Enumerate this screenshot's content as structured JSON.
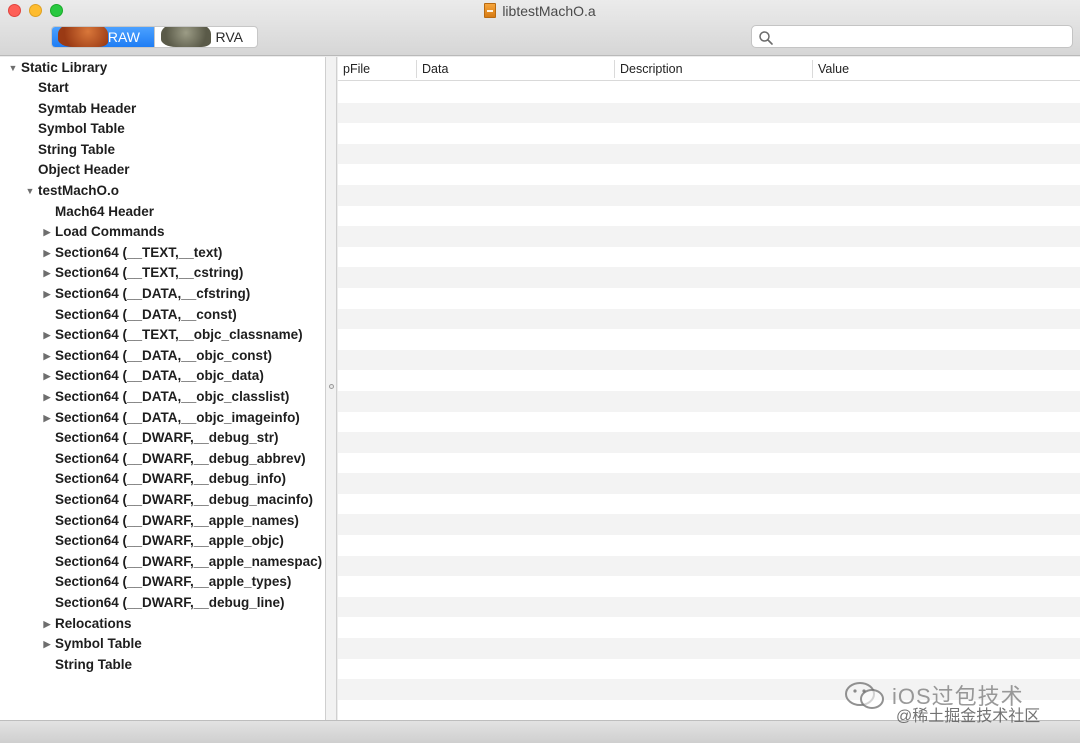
{
  "window": {
    "title": "libtestMachO.a"
  },
  "toolbar": {
    "mode_raw": "RAW",
    "mode_rva": "RVA",
    "search_value": "",
    "search_placeholder": ""
  },
  "sidebar": {
    "items": [
      {
        "label": "Static Library",
        "expanded": true
      },
      {
        "label": "Start"
      },
      {
        "label": "Symtab Header"
      },
      {
        "label": "Symbol Table"
      },
      {
        "label": "String Table"
      },
      {
        "label": "Object Header"
      },
      {
        "label": "testMachO.o",
        "expanded": true
      },
      {
        "label": "Mach64 Header"
      },
      {
        "label": "Load Commands",
        "expandable": true
      },
      {
        "label": "Section64 (__TEXT,__text)",
        "expandable": true
      },
      {
        "label": "Section64 (__TEXT,__cstring)",
        "expandable": true
      },
      {
        "label": "Section64 (__DATA,__cfstring)",
        "expandable": true
      },
      {
        "label": "Section64 (__DATA,__const)"
      },
      {
        "label": "Section64 (__TEXT,__objc_classname)",
        "expandable": true
      },
      {
        "label": "Section64 (__DATA,__objc_const)",
        "expandable": true
      },
      {
        "label": "Section64 (__DATA,__objc_data)",
        "expandable": true
      },
      {
        "label": "Section64 (__DATA,__objc_classlist)",
        "expandable": true
      },
      {
        "label": "Section64 (__DATA,__objc_imageinfo)",
        "expandable": true
      },
      {
        "label": "Section64 (__DWARF,__debug_str)"
      },
      {
        "label": "Section64 (__DWARF,__debug_abbrev)"
      },
      {
        "label": "Section64 (__DWARF,__debug_info)"
      },
      {
        "label": "Section64 (__DWARF,__debug_macinfo)"
      },
      {
        "label": "Section64 (__DWARF,__apple_names)"
      },
      {
        "label": "Section64 (__DWARF,__apple_objc)"
      },
      {
        "label": "Section64 (__DWARF,__apple_namespac)"
      },
      {
        "label": "Section64 (__DWARF,__apple_types)"
      },
      {
        "label": "Section64 (__DWARF,__debug_line)"
      },
      {
        "label": "Relocations",
        "expandable": true
      },
      {
        "label": "Symbol Table",
        "expandable": true
      },
      {
        "label": "String Table"
      }
    ]
  },
  "table": {
    "columns": [
      "pFile",
      "Data",
      "Description",
      "Value"
    ],
    "rows": []
  },
  "watermark": {
    "title": "iOS过包技术",
    "subtitle": "@稀土掘金技术社区"
  }
}
